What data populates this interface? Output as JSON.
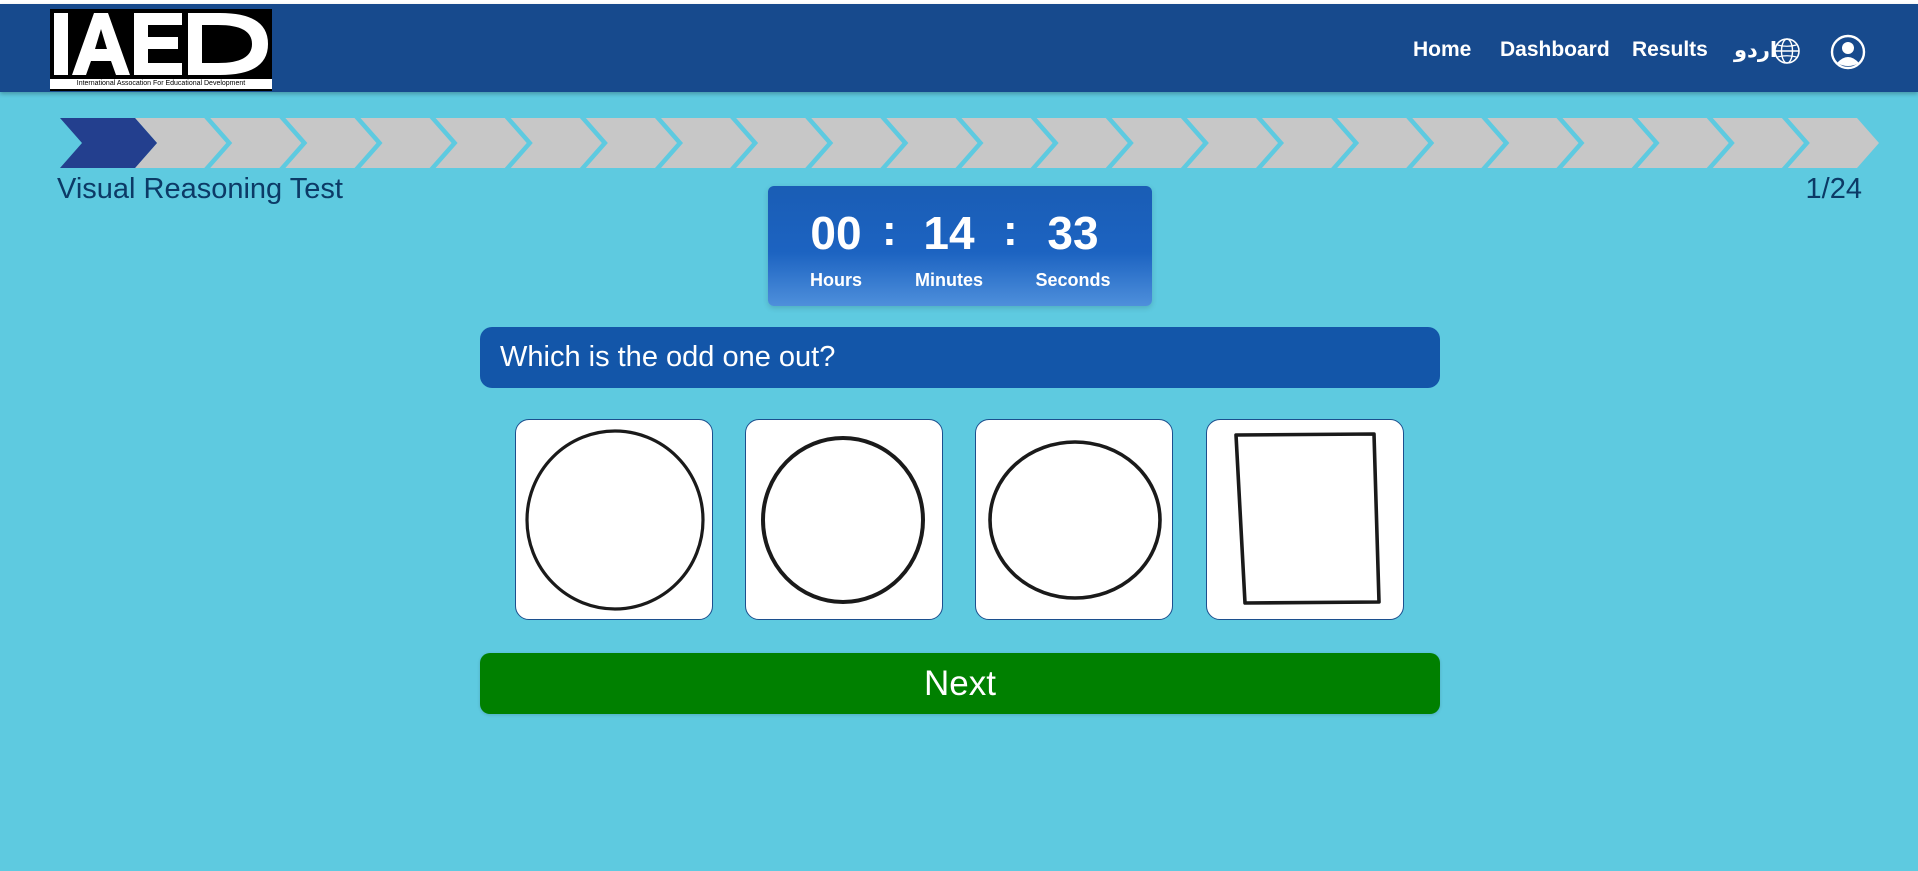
{
  "header": {
    "logo_text": "IAED",
    "logo_tagline": "International Assocation For Educational Development",
    "nav": {
      "home": "Home",
      "dashboard": "Dashboard",
      "results": "Results",
      "language": "اردو"
    },
    "colors": {
      "background": "#174a8d",
      "text": "#ffffff"
    }
  },
  "progress": {
    "total_steps": 24,
    "current_step": 1,
    "colors": {
      "active": "#233f8e",
      "inactive": "#c7c7c7"
    }
  },
  "test": {
    "title": "Visual Reasoning Test",
    "counter": "1/24"
  },
  "timer": {
    "hours": "00",
    "minutes": "14",
    "seconds": "33",
    "separator": ":",
    "hours_label": "Hours",
    "minutes_label": "Minutes",
    "seconds_label": "Seconds"
  },
  "question": {
    "text": "Which is the odd one out?",
    "options": [
      {
        "shape": "circle"
      },
      {
        "shape": "circle"
      },
      {
        "shape": "oval"
      },
      {
        "shape": "rectangle"
      }
    ]
  },
  "actions": {
    "next_label": "Next",
    "next_color": "#008000"
  },
  "colors": {
    "page_background": "#5ecae0",
    "question_background": "#1356a9",
    "title_text": "#0c3a66"
  }
}
